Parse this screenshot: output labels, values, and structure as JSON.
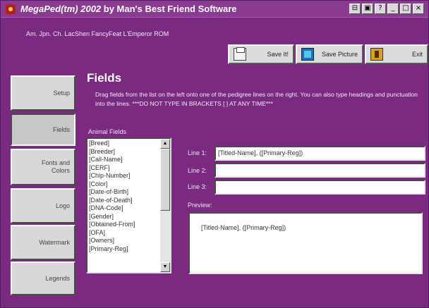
{
  "window": {
    "title_italic": "MegaPed(tm) 2002",
    "title_rest": " by Man's Best Friend Software",
    "buttons": [
      "⊟",
      "▣",
      "?",
      "_",
      "□",
      "×"
    ]
  },
  "dog_name": "Am. Jpn. Ch. LacShen FancyFeat L'Emperor ROM",
  "toolbar": {
    "save_label": "Save It!",
    "save_picture_label": "Save Picture",
    "exit_label": "Exit"
  },
  "sidebar": {
    "setup": "Setup",
    "fields": "Fields",
    "fonts_line1": "Fonts and",
    "fonts_line2": "Colors",
    "logo": "Logo",
    "watermark": "Watermark",
    "legends": "Legends"
  },
  "main": {
    "heading": "Fields",
    "instructions": "Drag fields from the list on the left onto one of the pedigree lines on the right.  You can also type headings and punctuation into the lines.  ***DO NOT TYPE IN BRACKETS [ ] AT ANY TIME***",
    "list_label": "Animal Fields",
    "fields": [
      "[Breed]",
      "[Breeder]",
      "[Call-Name]",
      "[CERF]",
      "[Chip-Number]",
      "[Color]",
      "[Date-of-Birth]",
      "[Date-of-Death]",
      "[DNA-Code]",
      "[Gender]",
      "[Obtained-From]",
      "[OFA]",
      "[Owners]",
      "[Primary-Reg]"
    ],
    "line1_label": "Line 1:",
    "line1_value": "[Titled-Name], ([Primary-Reg])",
    "line2_label": "Line 2:",
    "line2_value": "",
    "line3_label": "Line 3:",
    "line3_value": "",
    "preview_label": "Preview:",
    "preview_text": "[Titled-Name], ([Primary-Reg])"
  },
  "colors": {
    "background": "#7a2a80",
    "titlebar": "#8a3a90",
    "button_face": "#d8d8d8"
  }
}
